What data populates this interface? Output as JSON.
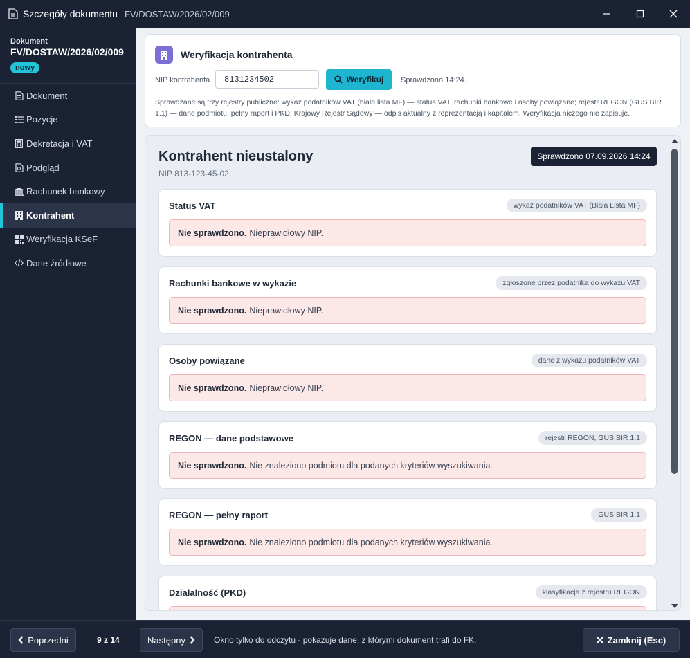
{
  "window": {
    "title": "Szczegóły dokumentu",
    "doc_number": "FV/DOSTAW/2026/02/009"
  },
  "sidebar": {
    "label": "Dokument",
    "number": "FV/DOSTAW/2026/02/009",
    "status": "nowy",
    "items": [
      {
        "label": "Dokument",
        "icon": "document-icon"
      },
      {
        "label": "Pozycje",
        "icon": "list-icon"
      },
      {
        "label": "Dekretacja i VAT",
        "icon": "calculator-icon"
      },
      {
        "label": "Podgląd",
        "icon": "file-preview-icon"
      },
      {
        "label": "Rachunek bankowy",
        "icon": "bank-icon"
      },
      {
        "label": "Kontrahent",
        "icon": "building-icon",
        "active": true
      },
      {
        "label": "Weryfikacja KSeF",
        "icon": "qrcode-icon"
      },
      {
        "label": "Dane źródłowe",
        "icon": "code-icon"
      }
    ]
  },
  "verify": {
    "title": "Weryfikacja kontrahenta",
    "nip_label": "NIP kontrahenta",
    "nip_value": "8131234502",
    "button": "Weryfikuj",
    "checked": "Sprawdzono 14:24.",
    "description": "Sprawdzane są trzy rejestry publiczne: wykaz podatników VAT (biała lista MF) — status VAT, rachunki bankowe i osoby powiązane; rejestr REGON (GUS BIR 1.1) — dane podmiotu, pełny raport i PKD; Krajowy Rejestr Sądowy — odpis aktualny z reprezentacją i kapitałem. Weryfikacja niczego nie zapisuje."
  },
  "result": {
    "heading": "Kontrahent nieustalony",
    "nip": "NIP 813-123-45-02",
    "stamp": "Sprawdzono 07.09.2026 14:24",
    "checks": [
      {
        "title": "Status VAT",
        "source": "wykaz podatników VAT (Biała Lista MF)",
        "status": "Nie sprawdzono.",
        "message": "Nieprawidłowy NIP."
      },
      {
        "title": "Rachunki bankowe w wykazie",
        "source": "zgłoszone przez podatnika do wykazu VAT",
        "status": "Nie sprawdzono.",
        "message": "Nieprawidłowy NIP."
      },
      {
        "title": "Osoby powiązane",
        "source": "dane z wykazu podatników VAT",
        "status": "Nie sprawdzono.",
        "message": "Nieprawidłowy NIP."
      },
      {
        "title": "REGON — dane podstawowe",
        "source": "rejestr REGON, GUS BIR 1.1",
        "status": "Nie sprawdzono.",
        "message": "Nie znaleziono podmiotu dla podanych kryteriów wyszukiwania."
      },
      {
        "title": "REGON — pełny raport",
        "source": "GUS BIR 1.1",
        "status": "Nie sprawdzono.",
        "message": "Nie znaleziono podmiotu dla podanych kryteriów wyszukiwania."
      },
      {
        "title": "Działalność (PKD)",
        "source": "klasyfikacja z rejestru REGON",
        "status": "",
        "message": ""
      }
    ]
  },
  "footer": {
    "prev": "Poprzedni",
    "pager": "9 z 14",
    "next": "Następny",
    "note": "Okno tylko do odczytu - pokazuje dane, z którymi dokument trafi do FK.",
    "close": "Zamknij (Esc)"
  },
  "colors": {
    "sidebar_bg": "#1b2233",
    "accent": "#22c4d8",
    "alert_bg": "#fde8e8",
    "icon_badge": "#7c6fd8"
  }
}
